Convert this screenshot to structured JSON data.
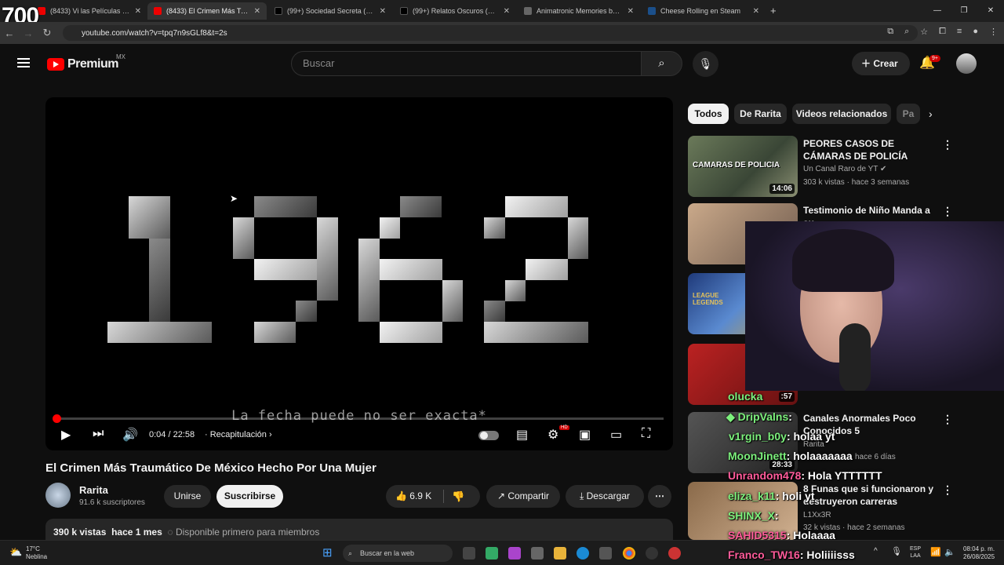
{
  "overlay_counter": "700",
  "tabs": [
    {
      "title": "(8433) Vi las Películas PROHIBIDAS",
      "active": false
    },
    {
      "title": "(8433) El Crimen Más Traumático",
      "active": true
    },
    {
      "title": "(99+) Sociedad Secreta (@sociedad",
      "active": false
    },
    {
      "title": "(99+) Relatos Oscuros (@relatos",
      "active": false
    },
    {
      "title": "Animatronic Memories by Inks",
      "active": false
    },
    {
      "title": "Cheese Rolling en Steam",
      "active": false
    }
  ],
  "address": {
    "url": "youtube.com/watch?v=tpq7n9sGLf8&t=2s"
  },
  "header": {
    "logo_text": "Premium",
    "region": "MX",
    "search_placeholder": "Buscar",
    "create_label": "Crear",
    "notifications_badge": "9+"
  },
  "player": {
    "caption": "La fecha puede no ser exacta*",
    "time": "0:04 / 22:58",
    "chapter": "Recapitulación",
    "progress_fraction": 0.003,
    "hd_badge": "HD"
  },
  "video": {
    "title": "El Crimen Más Traumático De México Hecho Por Una Mujer",
    "channel": "Rarita",
    "subscribers": "91.6 k suscriptores",
    "join_label": "Unirse",
    "subscribe_label": "Suscribirse",
    "likes": "6.9 K",
    "share_label": "Compartir",
    "download_label": "Descargar",
    "views": "390 k vistas",
    "age": "hace 1 mes",
    "members_note": "Disponible primero para miembros"
  },
  "chips": [
    "Todos",
    "De Rarita",
    "Videos relacionados",
    "Pa"
  ],
  "related": [
    {
      "title": "PEORES CASOS DE CÁMARAS DE POLICÍA",
      "channel": "Un Canal Raro de YT",
      "meta": "303 k vistas · hace 3 semanas",
      "duration": "14:06",
      "thumb_text": "CAMARAS DE POLICIA"
    },
    {
      "title": "Testimonio de Niño Manda a su",
      "channel": "",
      "meta": "",
      "duration": ""
    },
    {
      "title": "",
      "channel": "",
      "meta": "",
      "duration": ""
    },
    {
      "title": "",
      "channel": "",
      "meta": "",
      "duration": ":57"
    },
    {
      "title": "Canales Anormales Poco Conocidos 5",
      "channel": "Rarita",
      "meta": "hace 6 días",
      "duration": "28:33"
    },
    {
      "title": "8 Funas que si funcionaron y destruyeron carreras",
      "channel": "L1Xx3R",
      "meta": "32 k vistas · hace 2 semanas",
      "duration": ""
    }
  ],
  "chat": [
    {
      "user": "olucka",
      "msg": ""
    },
    {
      "user": "DripValns",
      "msg": ": "
    },
    {
      "user": "v1rgin_b0y",
      "msg": ": holaa yt"
    },
    {
      "user": "MoonJinett",
      "msg": ": holaaaaaaa"
    },
    {
      "user": "Unrandom478",
      "msg": ": Hola YTTTTTT"
    },
    {
      "user": "eliza_k11",
      "msg": ": holi yt"
    },
    {
      "user": "SHINX_X",
      "msg": ":"
    },
    {
      "user": "SAHID5315",
      "msg": ": Holaaaa"
    },
    {
      "user": "Franco_TW16",
      "msg": ": Holiiiisss"
    }
  ],
  "taskbar": {
    "temp": "17°C",
    "weather": "Neblina",
    "search": "Buscar en la web",
    "lang1": "ESP",
    "lang2": "LAA",
    "time": "08:04 p. m.",
    "date": "26/08/2025"
  }
}
